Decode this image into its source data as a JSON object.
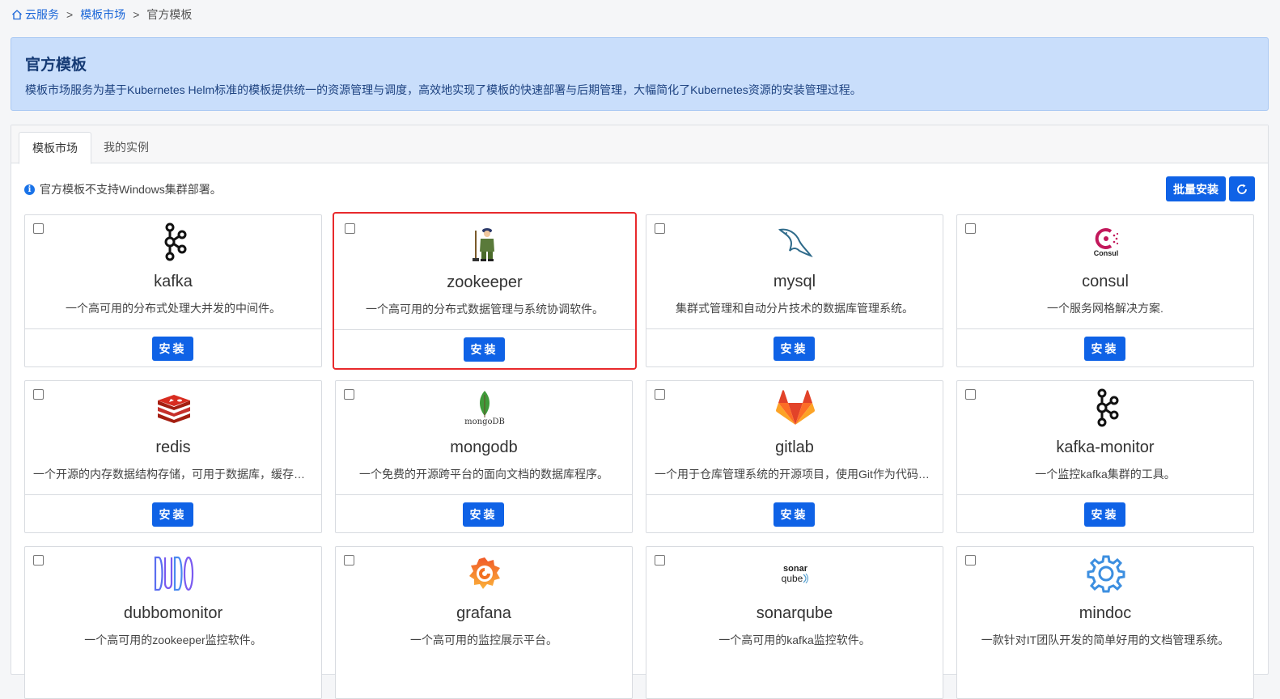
{
  "breadcrumb": {
    "home": "云服务",
    "market": "模板市场",
    "current": "官方模板",
    "separator": ">"
  },
  "banner": {
    "title": "官方模板",
    "description": "模板市场服务为基于Kubernetes Helm标准的模板提供统一的资源管理与调度，高效地实现了模板的快速部署与后期管理，大幅简化了Kubernetes资源的安装管理过程。"
  },
  "tabs": [
    {
      "label": "模板市场",
      "active": true
    },
    {
      "label": "我的实例",
      "active": false
    }
  ],
  "notice": {
    "icon": "info-icon",
    "text": "官方模板不支持Windows集群部署。"
  },
  "toolbar": {
    "batch_install": "批量安装",
    "refresh_icon": "refresh-icon"
  },
  "install_label": "安装",
  "templates": [
    {
      "name": "kafka",
      "desc": "一个高可用的分布式处理大并发的中间件。",
      "icon": "kafka-icon"
    },
    {
      "name": "zookeeper",
      "desc": "一个高可用的分布式数据管理与系统协调软件。",
      "icon": "zookeeper-icon",
      "highlighted": true
    },
    {
      "name": "mysql",
      "desc": "集群式管理和自动分片技术的数据库管理系统。",
      "icon": "mysql-dolphin-icon"
    },
    {
      "name": "consul",
      "desc": "一个服务网格解决方案.",
      "icon": "consul-icon",
      "logo_text": "Consul"
    },
    {
      "name": "redis",
      "desc": "一个开源的内存数据结构存储，可用于数据库，缓存和消息代理",
      "icon": "redis-icon"
    },
    {
      "name": "mongodb",
      "desc": "一个免费的开源跨平台的面向文档的数据库程序。",
      "icon": "mongodb-leaf-icon",
      "logo_text": "mongoDB"
    },
    {
      "name": "gitlab",
      "desc": "一个用于仓库管理系统的开源项目，使用Git作为代码管理工具",
      "icon": "gitlab-fox-icon"
    },
    {
      "name": "kafka-monitor",
      "desc": "一个监控kafka集群的工具。",
      "icon": "kafka-icon"
    },
    {
      "name": "dubbomonitor",
      "desc": "一个高可用的zookeeper监控软件。",
      "icon": "dubbo-icon"
    },
    {
      "name": "grafana",
      "desc": "一个高可用的监控展示平台。",
      "icon": "grafana-icon"
    },
    {
      "name": "sonarqube",
      "desc": "一个高可用的kafka监控软件。",
      "icon": "sonarqube-icon",
      "logo_text": [
        "sonar",
        "qube"
      ]
    },
    {
      "name": "mindoc",
      "desc": "一款针对IT团队开发的简单好用的文档管理系统。",
      "icon": "gear-icon"
    }
  ]
}
